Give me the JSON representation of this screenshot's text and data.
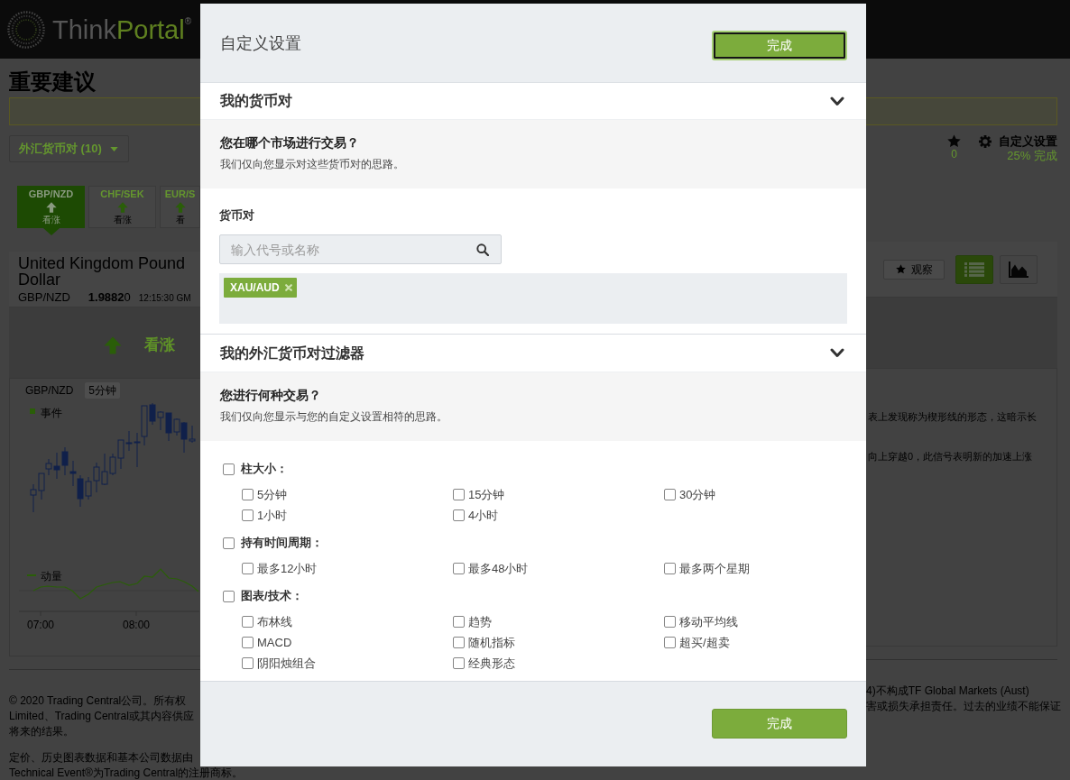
{
  "top_bar": {
    "logo": [
      {
        "text": "Think",
        "accent": false
      },
      {
        "text": "Portal$^{®}$",
        "accent": true
      }
    ]
  },
  "page": {
    "title": "重要建议",
    "filter_dropdown": {
      "label": "外汇货币对 (10)"
    },
    "watchlist": {
      "count": "0"
    },
    "customize": {
      "label": "自定义设置",
      "progress": "25% 完成"
    },
    "tiles": [
      {
        "symbol": "GBP/NZD",
        "signal": "看涨",
        "selected": true
      },
      {
        "symbol": "CHF/SEK",
        "signal": "看涨",
        "selected": false
      },
      {
        "symbol": "EUR/S",
        "signal": "看",
        "selected": false
      }
    ],
    "instrument": {
      "name_lines": [
        "United Kingdom Pound",
        "Dollar"
      ],
      "symbol": "GBP/NZD",
      "price": "**1.9882**0",
      "time": "12:15:30 GM",
      "watch_button": "观察",
      "views": [
        {
          "kind": "list",
          "selected": true
        },
        {
          "kind": "chart",
          "selected": false
        }
      ]
    },
    "signal": {
      "label": "看涨"
    },
    "chart": {
      "symbol": "GBP/NZD",
      "timeframe": "5分钟",
      "legend": [
        {
          "kind": "square",
          "label": "事件"
        },
        {
          "kind": "line",
          "label": "动量"
        }
      ],
      "x_labels": [
        "07:00",
        "08:00"
      ]
    },
    "analysis_fragments": [
      "表上发现称为楔形线的形态，这暗示长",
      "向上穿越0，此信号表明新的加速上涨"
    ]
  },
  "footer": {
    "lines": [
      {
        "left": "© 2020 Trading Central公司。所有权",
        "right": "4)不构成TF Global Markets (Aust)"
      },
      {
        "left": "Limited、Trading Central或其内容供应",
        "right": "害或损失承担责任。过去的业绩不能保证"
      },
      {
        "left": "将来的结果。"
      }
    ],
    "pricing_note": "定价、历史图表数据和基本公司数据由",
    "trademark_note": "Technical Event®为Trading Central的注册商标。"
  },
  "modal": {
    "title": "自定义设置",
    "header_button": {
      "label": "完成",
      "focused": true
    },
    "sections": [
      {
        "kind": "pairs",
        "title": "我的货币对",
        "expanded": true,
        "question": "您在哪个市场进行交易？",
        "hint": "我们仅向您显示对这些货币对的思路。",
        "field_label": "货币对",
        "search": {
          "placeholder": "输入代号或名称"
        },
        "tags": [
          {
            "label": "XAU/AUD"
          }
        ]
      },
      {
        "kind": "filters",
        "title": "我的外汇货币对过滤器",
        "expanded": true,
        "question": "您进行何种交易？",
        "hint": "我们仅向您显示与您的自定义设置相符的思路。",
        "groups": [
          {
            "label": "柱大小：",
            "checked": false,
            "options": [
              {
                "label": "5分钟",
                "checked": false
              },
              {
                "label": "15分钟",
                "checked": false
              },
              {
                "label": "30分钟",
                "checked": false
              },
              {
                "label": "1小时",
                "checked": false
              },
              {
                "label": "4小时",
                "checked": false
              }
            ]
          },
          {
            "label": "持有时间周期：",
            "checked": false,
            "options": [
              {
                "label": "最多12小时",
                "checked": false
              },
              {
                "label": "最多48小时",
                "checked": false
              },
              {
                "label": "最多两个星期",
                "checked": false
              }
            ]
          },
          {
            "label": "图表/技术：",
            "checked": false,
            "options": [
              {
                "label": "布林线",
                "checked": false
              },
              {
                "label": "趋势",
                "checked": false
              },
              {
                "label": "移动平均线",
                "checked": false
              },
              {
                "label": "MACD",
                "checked": false
              },
              {
                "label": "随机指标",
                "checked": false
              },
              {
                "label": "超买/超卖",
                "checked": false
              },
              {
                "label": "阴阳烛组合",
                "checked": false
              },
              {
                "label": "经典形态",
                "checked": false
              }
            ]
          }
        ]
      }
    ],
    "footer_button": {
      "label": "完成",
      "focused": false
    }
  }
}
